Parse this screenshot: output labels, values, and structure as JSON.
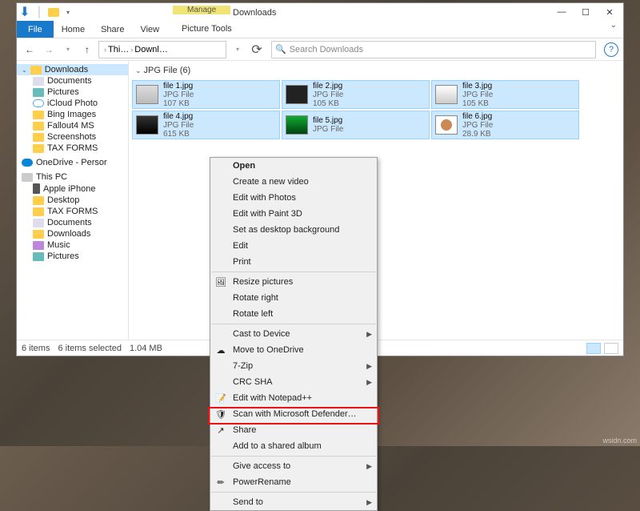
{
  "window": {
    "title": "Downloads",
    "ribbon": {
      "file": "File",
      "tabs": [
        "Home",
        "Share",
        "View"
      ],
      "context_label": "Manage",
      "context_tab": "Picture Tools"
    },
    "nav": {
      "breadcrumb": [
        "Thi…",
        "Downl…"
      ],
      "search_placeholder": "Search Downloads"
    }
  },
  "sidebar": {
    "groups": [
      {
        "label": "Downloads",
        "icon": "folder",
        "selected": true,
        "root": true
      },
      {
        "label": "Documents",
        "icon": "doc"
      },
      {
        "label": "Pictures",
        "icon": "pic"
      },
      {
        "label": "iCloud Photo",
        "icon": "cloud"
      },
      {
        "label": "Bing Images",
        "icon": "folder"
      },
      {
        "label": "Fallout4 MS",
        "icon": "folder"
      },
      {
        "label": "Screenshots",
        "icon": "folder"
      },
      {
        "label": "TAX FORMS",
        "icon": "folder"
      }
    ],
    "onedrive": "OneDrive - Persor",
    "thispc": "This PC",
    "pc_items": [
      {
        "label": "Apple iPhone",
        "icon": "phone"
      },
      {
        "label": "Desktop",
        "icon": "folder"
      },
      {
        "label": "TAX FORMS",
        "icon": "folder"
      },
      {
        "label": "Documents",
        "icon": "doc"
      },
      {
        "label": "Downloads",
        "icon": "folder"
      },
      {
        "label": "Music",
        "icon": "music"
      },
      {
        "label": "Pictures",
        "icon": "pic"
      }
    ]
  },
  "content": {
    "group_header": "JPG File (6)",
    "files": [
      {
        "name": "file 1.jpg",
        "type": "JPG File",
        "size": "107 KB",
        "thumb": "t1"
      },
      {
        "name": "file 2.jpg",
        "type": "JPG File",
        "size": "105 KB",
        "thumb": "t2"
      },
      {
        "name": "file 3.jpg",
        "type": "JPG File",
        "size": "105 KB",
        "thumb": "t3"
      },
      {
        "name": "file 4.jpg",
        "type": "JPG File",
        "size": "615 KB",
        "thumb": "t4"
      },
      {
        "name": "file 5.jpg",
        "type": "JPG File",
        "size": "",
        "thumb": "t5"
      },
      {
        "name": "file 6.jpg",
        "type": "JPG File",
        "size": "28.9 KB",
        "thumb": "t6"
      }
    ]
  },
  "statusbar": {
    "items_count": "6 items",
    "selected": "6 items selected",
    "size": "1.04 MB"
  },
  "context_menu": [
    {
      "label": "Open",
      "bold": true
    },
    {
      "label": "Create a new video"
    },
    {
      "label": "Edit with Photos"
    },
    {
      "label": "Edit with Paint 3D"
    },
    {
      "label": "Set as desktop background"
    },
    {
      "label": "Edit"
    },
    {
      "label": "Print"
    },
    {
      "sep": true
    },
    {
      "label": "Resize pictures",
      "icon": "🖼"
    },
    {
      "label": "Rotate right"
    },
    {
      "label": "Rotate left"
    },
    {
      "sep": true
    },
    {
      "label": "Cast to Device",
      "arrow": true
    },
    {
      "label": "Move to OneDrive",
      "icon": "☁"
    },
    {
      "label": "7-Zip",
      "arrow": true
    },
    {
      "label": "CRC SHA",
      "arrow": true
    },
    {
      "label": "Edit with Notepad++",
      "icon": "📝"
    },
    {
      "label": "Scan with Microsoft Defender…",
      "icon": "🛡"
    },
    {
      "label": "Share",
      "icon": "↗"
    },
    {
      "label": "Add to a shared album"
    },
    {
      "sep": true
    },
    {
      "label": "Give access to",
      "arrow": true
    },
    {
      "label": "PowerRename",
      "icon": "✏",
      "highlight": true
    },
    {
      "sep": true
    },
    {
      "label": "Send to",
      "arrow": true
    }
  ],
  "watermark": "wsidn.com"
}
